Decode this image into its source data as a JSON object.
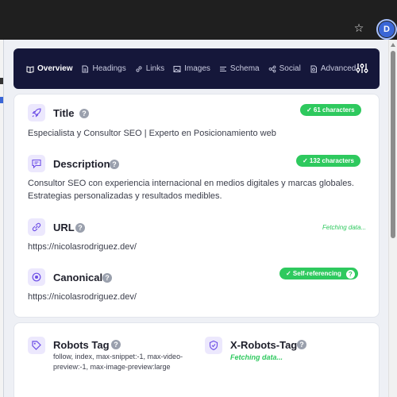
{
  "browser": {
    "avatar_letter": "D",
    "star_glyph": "☆"
  },
  "nav": {
    "tabs": [
      {
        "label": "Overview",
        "icon": "book-icon",
        "active": true
      },
      {
        "label": "Headings",
        "icon": "document-icon",
        "active": false
      },
      {
        "label": "Links",
        "icon": "link-icon",
        "active": false
      },
      {
        "label": "Images",
        "icon": "image-icon",
        "active": false
      },
      {
        "label": "Schema",
        "icon": "list-icon",
        "active": false
      },
      {
        "label": "Social",
        "icon": "share-icon",
        "active": false
      },
      {
        "label": "Advanced",
        "icon": "file-search-icon",
        "active": false
      }
    ],
    "settings_icon": "sliders-icon"
  },
  "fields": {
    "title": {
      "label": "Title",
      "badge": "✓ 61 characters",
      "value": "Especialista y Consultor SEO | Experto en Posicionamiento web"
    },
    "description": {
      "label": "Description",
      "badge": "✓ 132 characters",
      "value": "Consultor SEO con experiencia internacional en medios digitales y marcas globales. Estrategias personalizadas y resultados medibles."
    },
    "url": {
      "label": "URL",
      "status": "Fetching data...",
      "value": "https://nicolasrodriguez.dev/"
    },
    "canonical": {
      "label": "Canonical",
      "badge": "✓ Self-referencing",
      "value": "https://nicolasrodriguez.dev/"
    },
    "robots_tag": {
      "label": "Robots Tag",
      "value": "follow, index, max-snippet:-1, max-video-preview:-1, max-image-preview:large"
    },
    "x_robots_tag": {
      "label": "X-Robots-Tag",
      "status": "Fetching data..."
    }
  },
  "help_glyph": "?",
  "colors": {
    "nav_bg": "#15173a",
    "accent_purple": "#6d4ee6",
    "icon_box_bg": "#ece8fd",
    "success_green": "#2ec95e"
  }
}
